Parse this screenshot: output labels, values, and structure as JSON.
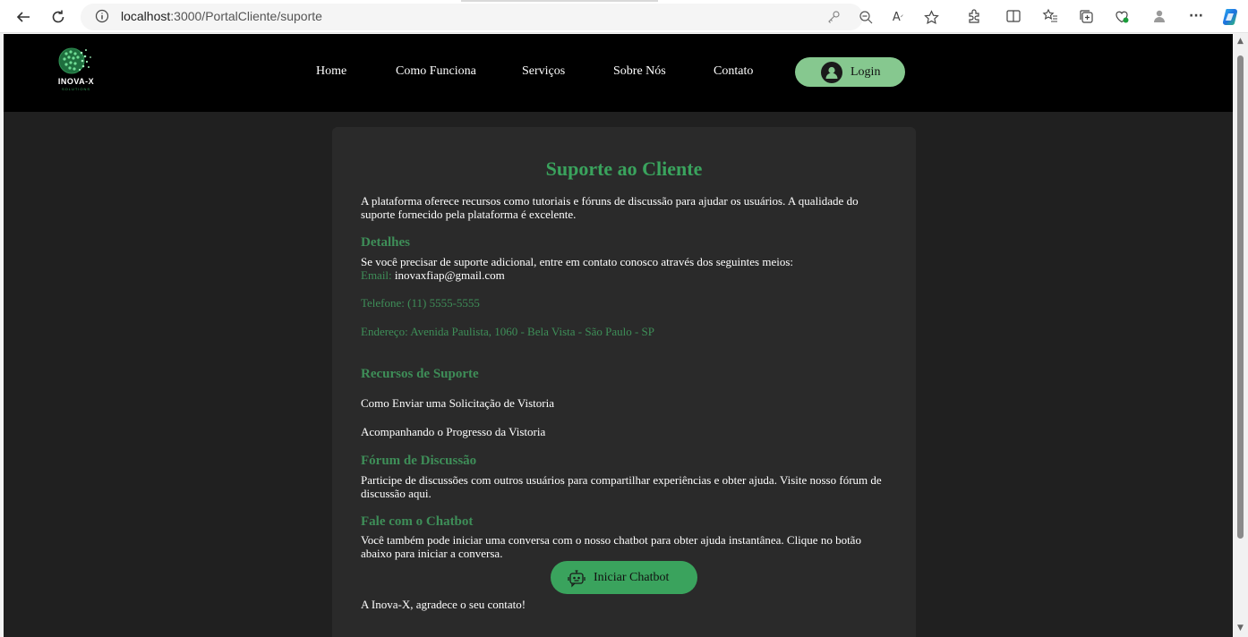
{
  "browser": {
    "url_host": "localhost",
    "url_path": ":3000/PortalCliente/suporte",
    "icons": [
      "back-icon",
      "refresh-icon",
      "info-icon",
      "key-icon",
      "zoom-icon",
      "read-aloud-icon",
      "favorite-star-icon",
      "extensions-icon",
      "split-screen-icon",
      "favorites-icon",
      "collections-icon",
      "browser-essentials-icon",
      "profile-icon",
      "more-icon",
      "copilot-icon"
    ]
  },
  "header": {
    "logo_text": "INOVA-X",
    "logo_sub": "SOLUTIONS",
    "menu": [
      "Home",
      "Como Funciona",
      "Serviços",
      "Sobre Nós",
      "Contato"
    ],
    "login_label": "Login"
  },
  "support": {
    "title": "Suporte ao Cliente",
    "intro": "A plataforma oferece recursos como tutoriais e fóruns de discussão para ajudar os usuários. A qualidade do suporte fornecido pela plataforma é excelente.",
    "details_heading": "Detalhes",
    "details_text": "Se você precisar de suporte adicional, entre em contato conosco através dos seguintes meios:",
    "email_label": "Email:",
    "email_value": "inovaxfiap@gmail.com",
    "phone": "Telefone: (11) 5555-5555",
    "address": "Endereço: Avenida Paulista, 1060 - Bela Vista - São Paulo - SP",
    "resources_heading": "Recursos de Suporte",
    "resource_1": "Como Enviar uma Solicitação de Vistoria",
    "resource_2": "Acompanhando o Progresso da Vistoria",
    "forum_heading": "Fórum de Discussão",
    "forum_text": "Participe de discussões com outros usuários para compartilhar experiências e obter ajuda. Visite nosso fórum de discussão ",
    "forum_link": "aqui",
    "forum_end": ".",
    "chatbot_heading": "Fale com o Chatbot",
    "chatbot_text": "Você também pode iniciar uma conversa com o nosso chatbot para obter ajuda instantânea. Clique no botão abaixo para iniciar a conversa.",
    "chatbot_button": "Iniciar Chatbot",
    "thanks": "A Inova-X, agradece o seu contato!"
  },
  "colors": {
    "accent_green": "#3aa35d",
    "login_green": "#86c88f",
    "page_bg": "#202020",
    "card_bg": "#2a2a2a"
  }
}
